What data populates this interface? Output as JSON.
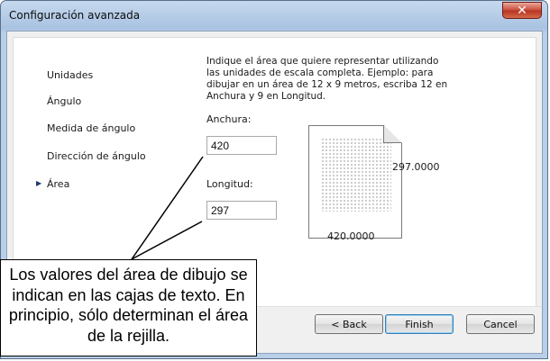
{
  "window": {
    "title": "Configuración avanzada",
    "close_label": "✕"
  },
  "nav": {
    "items": [
      {
        "label": "Unidades",
        "active": false
      },
      {
        "label": "Ángulo",
        "active": false
      },
      {
        "label": "Medida de ángulo",
        "active": false
      },
      {
        "label": "Dirección de ángulo",
        "active": false
      },
      {
        "label": "Área",
        "active": true
      }
    ],
    "active_marker": "▶"
  },
  "content": {
    "description": "Indique el área que quiere representar utilizando las unidades de escala completa. Ejemplo: para dibujar en un área de 12 x 9 metros, escriba 12 en Anchura y 9 en Longitud.",
    "width_label": "Anchura:",
    "width_value": "420",
    "length_label": "Longitud:",
    "length_value": "297",
    "preview_height_label": "297.0000",
    "preview_width_label": "420.0000"
  },
  "buttons": {
    "back": "< Back",
    "finish": "Finish",
    "cancel": "Cancel"
  },
  "annotation": {
    "text": "Los valores del área de dibujo se indican en las cajas de texto. En principio, sólo determinan el área de la rejilla."
  }
}
